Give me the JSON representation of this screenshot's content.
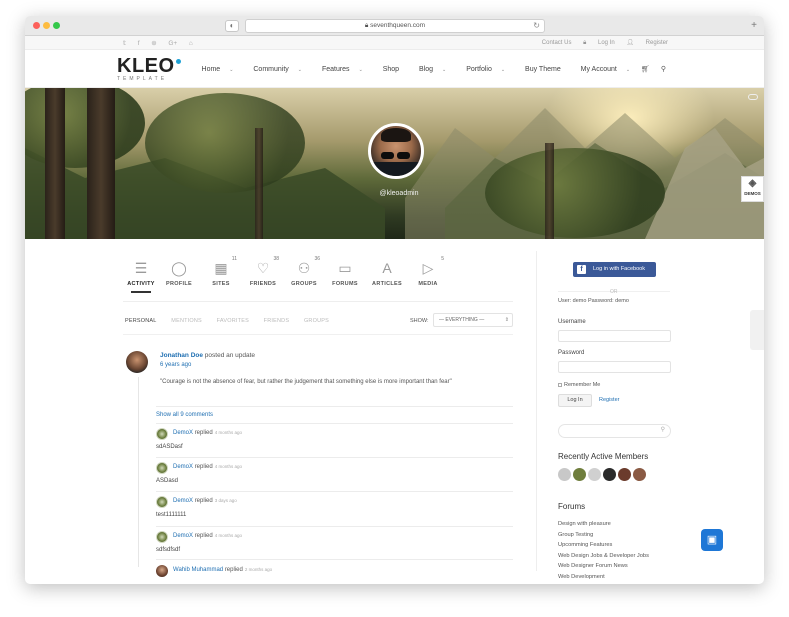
{
  "browser": {
    "url": "seventhqueen.com"
  },
  "topbar": {
    "social_icons": [
      "twitter-icon",
      "facebook-icon",
      "dribbble-icon",
      "google-plus-icon",
      "lock-icon"
    ],
    "links": [
      "Contact Us",
      "Log In",
      "Register"
    ]
  },
  "header": {
    "logo": "KLEO",
    "logo_sub": "TEMPLATE",
    "nav": [
      {
        "label": "Home",
        "dropdown": true
      },
      {
        "label": "Community",
        "dropdown": true
      },
      {
        "label": "Features",
        "dropdown": true
      },
      {
        "label": "Shop",
        "dropdown": false
      },
      {
        "label": "Blog",
        "dropdown": true
      },
      {
        "label": "Portfolio",
        "dropdown": true
      },
      {
        "label": "Buy Theme",
        "dropdown": false
      },
      {
        "label": "My Account",
        "dropdown": true
      }
    ]
  },
  "profile": {
    "handle": "@kleoadmin",
    "demos_label": "DEMOS"
  },
  "tabs": [
    {
      "label": "ACTIVITY",
      "count": "",
      "icon": "activity-list-icon",
      "glyph": "☰",
      "active": true
    },
    {
      "label": "PROFILE",
      "count": "",
      "icon": "profile-icon",
      "glyph": "◯",
      "active": false
    },
    {
      "label": "SITES",
      "count": "11",
      "icon": "sites-icon",
      "glyph": "▦",
      "active": false
    },
    {
      "label": "FRIENDS",
      "count": "38",
      "icon": "friends-heart-icon",
      "glyph": "♡",
      "active": false
    },
    {
      "label": "GROUPS",
      "count": "36",
      "icon": "groups-icon",
      "glyph": "⚇",
      "active": false
    },
    {
      "label": "FORUMS",
      "count": "",
      "icon": "forums-icon",
      "glyph": "▭",
      "active": false
    },
    {
      "label": "ARTICLES",
      "count": "",
      "icon": "articles-icon",
      "glyph": "A",
      "active": false
    },
    {
      "label": "MEDIA",
      "count": "5",
      "icon": "media-icon",
      "glyph": "▷",
      "active": false
    }
  ],
  "subnav": {
    "items": [
      "PERSONAL",
      "MENTIONS",
      "FAVORITES",
      "FRIENDS",
      "GROUPS"
    ],
    "show_label": "SHOW:",
    "show_value": "— EVERYTHING —"
  },
  "post": {
    "author": "Jonathan Doe",
    "action": "posted an update",
    "time": "6 years ago",
    "text": "\"Courage is not the absence of fear, but rather the judgement that something else is more important than fear\"",
    "show_all": "Show all 9 comments"
  },
  "comments": [
    {
      "author": "DemoX",
      "action": "replied",
      "time": "4 months ago",
      "text": "sdASDasf"
    },
    {
      "author": "DemoX",
      "action": "replied",
      "time": "4 months ago",
      "text": "ASDasd"
    },
    {
      "author": "DemoX",
      "action": "replied",
      "time": "3 days ago",
      "text": "test1111111"
    },
    {
      "author": "DemoX",
      "action": "replied",
      "time": "4 months ago",
      "text": "sdfsdfsdf"
    },
    {
      "author": "Wahib Muhammad",
      "action": "replied",
      "time": "2 months ago",
      "text": ""
    }
  ],
  "sidebar": {
    "fb_button": "Log in with Facebook",
    "or": "OR",
    "demo_creds": "User: demo Password: demo",
    "username_label": "Username",
    "password_label": "Password",
    "remember": "Remember Me",
    "login_button": "Log In",
    "register_link": "Register",
    "members_title": "Recently Active Members",
    "members_colors": [
      "#c8c8c8",
      "#6f7e3d",
      "#d0d0d0",
      "#2b2b2b",
      "#6b3b2c",
      "#8a5a44"
    ],
    "forums_title": "Forums",
    "forums": [
      "Design with pleasure",
      "Group Testing",
      "Upcomming Features",
      "Web Design Jobs & Developer Jobs",
      "Web Designer Forum News",
      "Web Development"
    ]
  },
  "colors": {
    "link": "#1f6fb2",
    "facebook": "#3b5998",
    "chat": "#1e77d6"
  }
}
